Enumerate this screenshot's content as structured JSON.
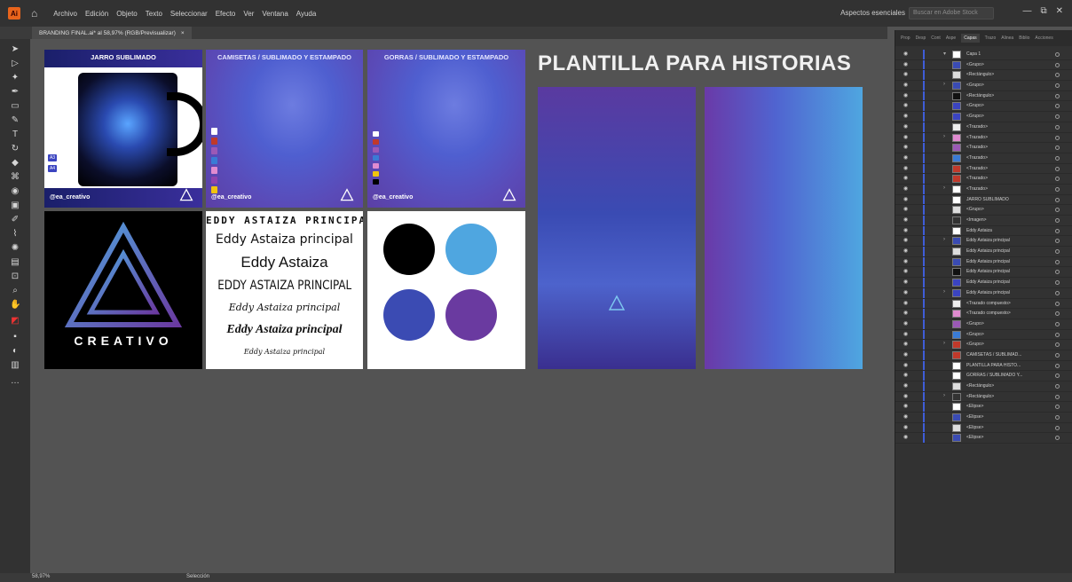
{
  "menubar": {
    "app_logo": "Ai",
    "items": [
      "Archivo",
      "Edición",
      "Objeto",
      "Texto",
      "Seleccionar",
      "Efecto",
      "Ver",
      "Ventana",
      "Ayuda"
    ],
    "workspace": "Aspectos esenciales",
    "search_placeholder": "Buscar en Adobe Stock",
    "window_controls": [
      "—",
      "⧉",
      "✕"
    ]
  },
  "document_tab": {
    "title": "BRANDING FINAL.ai* al 58,97% (RGB/Previsualizar)",
    "close": "×"
  },
  "artboards": {
    "mug": {
      "header": "JARRO SUBLIMADO",
      "sizes": [
        "A3",
        "A4"
      ],
      "footer": "@ea_creativo"
    },
    "shirts": {
      "header": "CAMISETAS / SUBLIMADO Y ESTAMPADO",
      "footer": "@ea_creativo"
    },
    "caps": {
      "header": "GORRAS / SUBLIMADO Y ESTAMPADO",
      "footer": "@ea_creativo"
    },
    "logo": {
      "wordmark": "CREATIVO"
    },
    "fonts": {
      "lines": [
        "EDDY ASTAIZA PRINCIPAL",
        "Eddy Astaiza principal",
        "Eddy Astaiza",
        "EDDY ASTAIZA PRINCIPAL",
        "Eddy Astaiza principal",
        "Eddy Astaiza principal",
        "Eddy Astaiza principal"
      ]
    },
    "colors": {
      "swatches": [
        "#000000",
        "#4fa6e0",
        "#3b4bb3",
        "#6a3aa0"
      ]
    },
    "historias": {
      "title": "PLANTILLA PARA HISTORIAS"
    }
  },
  "layers_panel": {
    "tabs": [
      "Prop",
      "Desp",
      "Cont",
      "Aspe",
      "Capas",
      "Trazo",
      "Alinea",
      "Biblio",
      "Acciones"
    ],
    "active_tab": "Capas",
    "layers": [
      {
        "name": "Capa 1",
        "expanded": true
      },
      {
        "name": "<Grupo>"
      },
      {
        "name": "<Rectángulo>"
      },
      {
        "name": "<Grupo>"
      },
      {
        "name": "<Rectángulo>"
      },
      {
        "name": "<Grupo>"
      },
      {
        "name": "<Grupo>"
      },
      {
        "name": "<Trazado>"
      },
      {
        "name": "<Trazado>"
      },
      {
        "name": "<Trazado>"
      },
      {
        "name": "<Trazado>"
      },
      {
        "name": "<Trazado>"
      },
      {
        "name": "<Trazado>"
      },
      {
        "name": "<Trazado>"
      },
      {
        "name": "JARRO SUBLIMADO"
      },
      {
        "name": "<Grupo>"
      },
      {
        "name": "<Imagen>"
      },
      {
        "name": "Eddy Astaiza"
      },
      {
        "name": "Eddy Astaiza principal"
      },
      {
        "name": "Eddy Astaiza principal"
      },
      {
        "name": "Eddy Astaiza principal"
      },
      {
        "name": "Eddy Astaiza principal"
      },
      {
        "name": "Eddy Astaiza principal"
      },
      {
        "name": "Eddy Astaiza principal"
      },
      {
        "name": "<Trazado compuesto>"
      },
      {
        "name": "<Trazado compuesto>"
      },
      {
        "name": "<Grupo>"
      },
      {
        "name": "<Grupo>"
      },
      {
        "name": "<Grupo>"
      },
      {
        "name": "CAMISETAS / SUBLIMAD..."
      },
      {
        "name": "PLANTILLA PARA HISTO..."
      },
      {
        "name": "GORRAS / SUBLIMADO Y..."
      },
      {
        "name": "<Rectángulo>"
      },
      {
        "name": "<Rectángulo>"
      },
      {
        "name": "<Elipse>"
      },
      {
        "name": "<Elipse>"
      },
      {
        "name": "<Elipse>"
      },
      {
        "name": "<Elipse>"
      }
    ]
  },
  "statusbar": {
    "zoom": "58,97%",
    "tool": "Selección"
  }
}
